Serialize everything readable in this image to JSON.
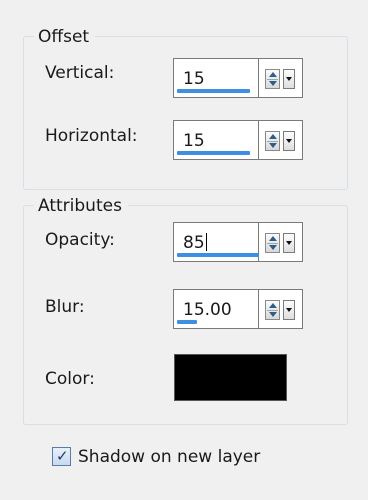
{
  "offset": {
    "title": "Offset",
    "vertical_label": "Vertical:",
    "vertical_value": "15",
    "vertical_level": 0.56,
    "horizontal_label": "Horizontal:",
    "horizontal_value": "15",
    "horizontal_level": 0.56
  },
  "attributes": {
    "title": "Attributes",
    "opacity_label": "Opacity:",
    "opacity_value": "85",
    "opacity_level": 0.85,
    "blur_label": "Blur:",
    "blur_value": "15.00",
    "blur_level": 0.15,
    "color_label": "Color:",
    "color_value": "#000000"
  },
  "shadow_option": {
    "label": "Shadow on new layer",
    "checked": true
  },
  "icons": {
    "spinner": "up-down-spin-icon",
    "dropdown": "chevron-down-icon",
    "check": "checkmark-icon"
  }
}
